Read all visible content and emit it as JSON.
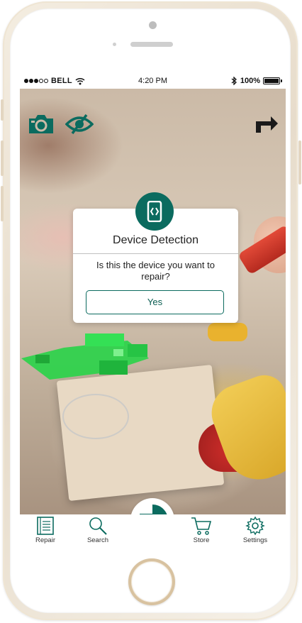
{
  "status_bar": {
    "carrier": "BELL",
    "time": "4:20 PM",
    "battery": "100%"
  },
  "toolbar": {
    "left_icons": [
      "camera-icon",
      "eye-toggle-icon"
    ],
    "right_icon": "share-icon"
  },
  "dialog": {
    "icon": "device-detection-icon",
    "title": "Device Detection",
    "message": "Is this the device you want to repair?",
    "confirm_label": "Yes"
  },
  "tabbar": {
    "items": [
      {
        "label": "Repair",
        "icon": "repair-manual-icon"
      },
      {
        "label": "Search",
        "icon": "search-icon"
      },
      {
        "label": "",
        "icon": "app-logo-icon"
      },
      {
        "label": "Store",
        "icon": "cart-icon"
      },
      {
        "label": "Settings",
        "icon": "gear-icon"
      }
    ]
  },
  "colors": {
    "accent": "#0b6b5f",
    "detected_highlight": "#2bd24a"
  }
}
